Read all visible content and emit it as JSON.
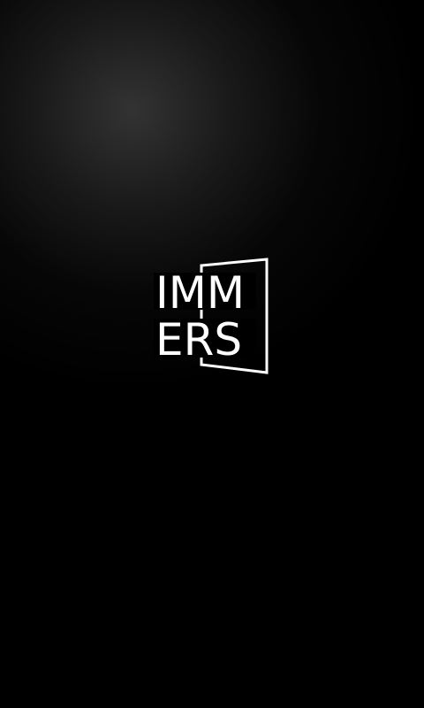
{
  "splash": {
    "logo": {
      "line1": "IMM",
      "line2": "ERS",
      "icon": "door-frame-icon"
    }
  },
  "colors": {
    "background": "#000000",
    "glow": "#3c3c3c",
    "logo": "#ffffff"
  }
}
